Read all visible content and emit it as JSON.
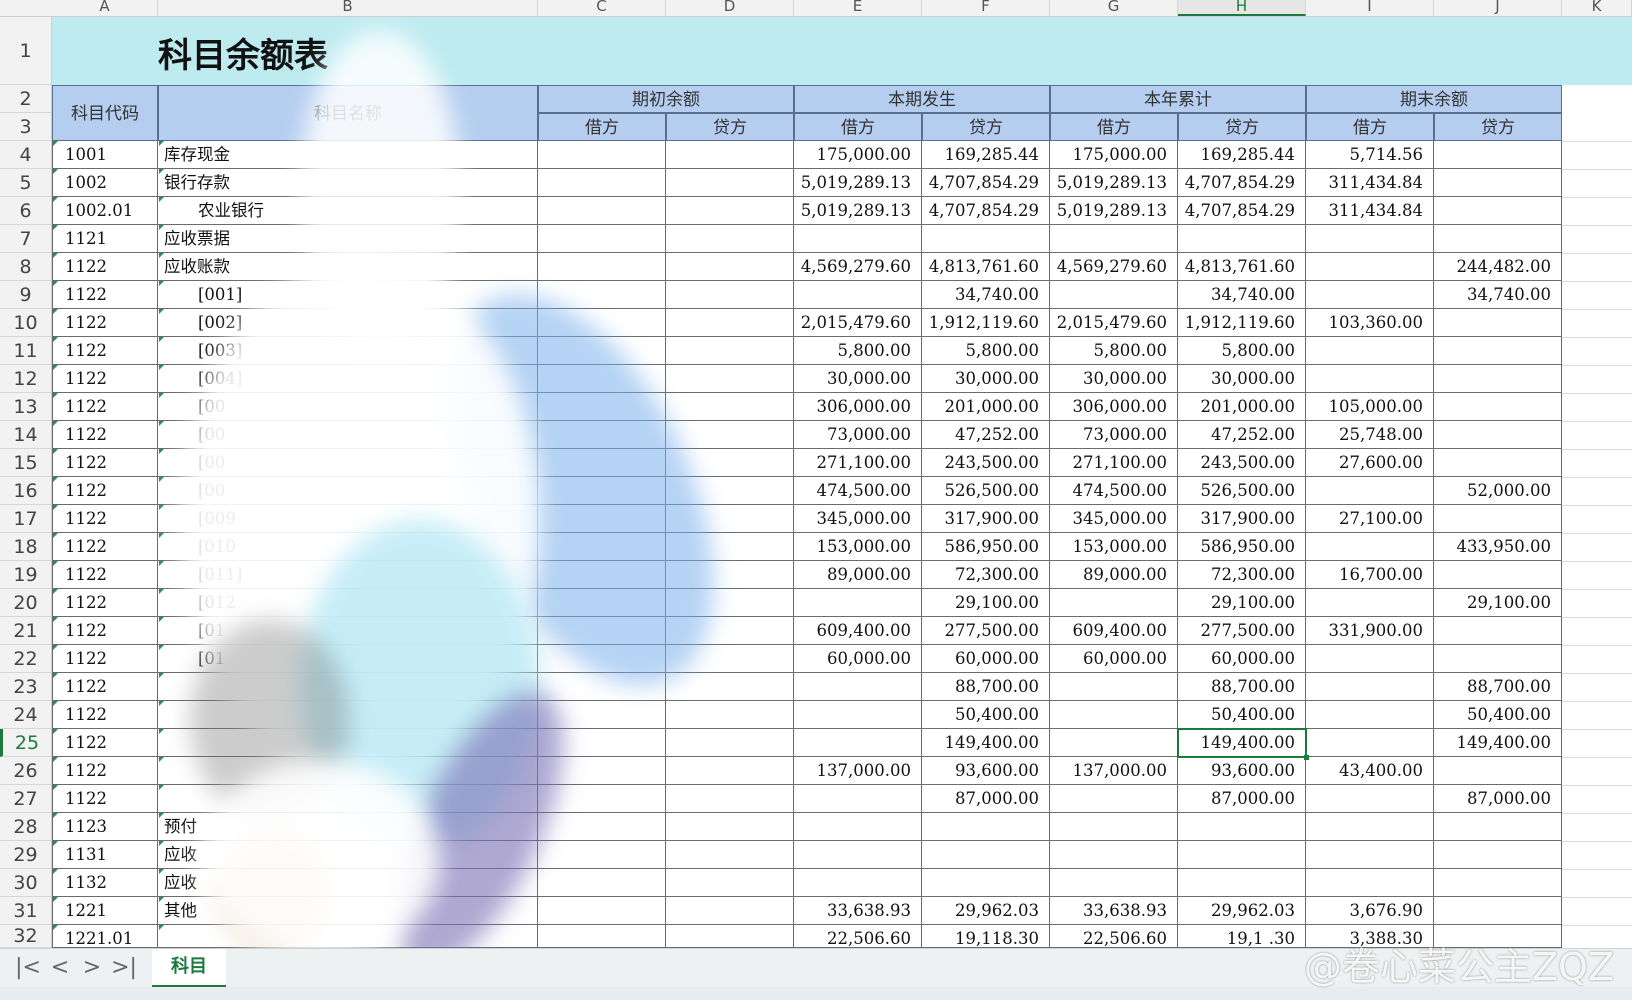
{
  "columns": [
    "A",
    "B",
    "C",
    "D",
    "E",
    "F",
    "G",
    "H",
    "I",
    "J",
    "K"
  ],
  "selected_column": "H",
  "selected_row": "25",
  "title": "科目余额表",
  "headers": {
    "code": "科目代码",
    "name": "科目名称",
    "groups": [
      "期初余额",
      "本期发生",
      "本年累计",
      "期末余额"
    ],
    "debit": "借方",
    "credit": "贷方"
  },
  "rows": [
    {
      "n": "4",
      "code": "1001",
      "name": "库存现金",
      "indent": false,
      "c": "",
      "d": "",
      "e": "175,000.00",
      "f": "169,285.44",
      "g": "175,000.00",
      "h": "169,285.44",
      "i": "5,714.56",
      "j": ""
    },
    {
      "n": "5",
      "code": "1002",
      "name": "银行存款",
      "indent": false,
      "c": "",
      "d": "",
      "e": "5,019,289.13",
      "f": "4,707,854.29",
      "g": "5,019,289.13",
      "h": "4,707,854.29",
      "i": "311,434.84",
      "j": ""
    },
    {
      "n": "6",
      "code": "1002.01",
      "name": "农业银行",
      "indent": true,
      "c": "",
      "d": "",
      "e": "5,019,289.13",
      "f": "4,707,854.29",
      "g": "5,019,289.13",
      "h": "4,707,854.29",
      "i": "311,434.84",
      "j": ""
    },
    {
      "n": "7",
      "code": "1121",
      "name": "应收票据",
      "indent": false,
      "c": "",
      "d": "",
      "e": "",
      "f": "",
      "g": "",
      "h": "",
      "i": "",
      "j": ""
    },
    {
      "n": "8",
      "code": "1122",
      "name": "应收账款",
      "indent": false,
      "c": "",
      "d": "",
      "e": "4,569,279.60",
      "f": "4,813,761.60",
      "g": "4,569,279.60",
      "h": "4,813,761.60",
      "i": "",
      "j": "244,482.00"
    },
    {
      "n": "9",
      "code": "1122",
      "name": "[001]",
      "indent": true,
      "c": "",
      "d": "",
      "e": "",
      "f": "34,740.00",
      "g": "",
      "h": "34,740.00",
      "i": "",
      "j": "34,740.00"
    },
    {
      "n": "10",
      "code": "1122",
      "name": "[002]",
      "indent": true,
      "c": "",
      "d": "",
      "e": "2,015,479.60",
      "f": "1,912,119.60",
      "g": "2,015,479.60",
      "h": "1,912,119.60",
      "i": "103,360.00",
      "j": ""
    },
    {
      "n": "11",
      "code": "1122",
      "name": "[003]",
      "indent": true,
      "c": "",
      "d": "",
      "e": "5,800.00",
      "f": "5,800.00",
      "g": "5,800.00",
      "h": "5,800.00",
      "i": "",
      "j": ""
    },
    {
      "n": "12",
      "code": "1122",
      "name": "[004]",
      "indent": true,
      "c": "",
      "d": "",
      "e": "30,000.00",
      "f": "30,000.00",
      "g": "30,000.00",
      "h": "30,000.00",
      "i": "",
      "j": ""
    },
    {
      "n": "13",
      "code": "1122",
      "name": "[00",
      "indent": true,
      "c": "",
      "d": "",
      "e": "306,000.00",
      "f": "201,000.00",
      "g": "306,000.00",
      "h": "201,000.00",
      "i": "105,000.00",
      "j": ""
    },
    {
      "n": "14",
      "code": "1122",
      "name": "[00",
      "indent": true,
      "c": "",
      "d": "",
      "e": "73,000.00",
      "f": "47,252.00",
      "g": "73,000.00",
      "h": "47,252.00",
      "i": "25,748.00",
      "j": ""
    },
    {
      "n": "15",
      "code": "1122",
      "name": "[00",
      "indent": true,
      "c": "",
      "d": "",
      "e": "271,100.00",
      "f": "243,500.00",
      "g": "271,100.00",
      "h": "243,500.00",
      "i": "27,600.00",
      "j": ""
    },
    {
      "n": "16",
      "code": "1122",
      "name": "[00",
      "indent": true,
      "c": "",
      "d": "",
      "e": "474,500.00",
      "f": "526,500.00",
      "g": "474,500.00",
      "h": "526,500.00",
      "i": "",
      "j": "52,000.00"
    },
    {
      "n": "17",
      "code": "1122",
      "name": "[009",
      "indent": true,
      "c": "",
      "d": "",
      "e": "345,000.00",
      "f": "317,900.00",
      "g": "345,000.00",
      "h": "317,900.00",
      "i": "27,100.00",
      "j": ""
    },
    {
      "n": "18",
      "code": "1122",
      "name": "[010",
      "indent": true,
      "c": "",
      "d": "",
      "e": "153,000.00",
      "f": "586,950.00",
      "g": "153,000.00",
      "h": "586,950.00",
      "i": "",
      "j": "433,950.00"
    },
    {
      "n": "19",
      "code": "1122",
      "name": "[011]",
      "indent": true,
      "c": "",
      "d": "",
      "e": "89,000.00",
      "f": "72,300.00",
      "g": "89,000.00",
      "h": "72,300.00",
      "i": "16,700.00",
      "j": ""
    },
    {
      "n": "20",
      "code": "1122",
      "name": "[012",
      "indent": true,
      "c": "",
      "d": "",
      "e": "",
      "f": "29,100.00",
      "g": "",
      "h": "29,100.00",
      "i": "",
      "j": "29,100.00"
    },
    {
      "n": "21",
      "code": "1122",
      "name": "[01",
      "indent": true,
      "c": "",
      "d": "",
      "e": "609,400.00",
      "f": "277,500.00",
      "g": "609,400.00",
      "h": "277,500.00",
      "i": "331,900.00",
      "j": ""
    },
    {
      "n": "22",
      "code": "1122",
      "name": "[01",
      "indent": true,
      "c": "",
      "d": "",
      "e": "60,000.00",
      "f": "60,000.00",
      "g": "60,000.00",
      "h": "60,000.00",
      "i": "",
      "j": ""
    },
    {
      "n": "23",
      "code": "1122",
      "name": "",
      "indent": true,
      "c": "",
      "d": "",
      "e": "",
      "f": "88,700.00",
      "g": "",
      "h": "88,700.00",
      "i": "",
      "j": "88,700.00"
    },
    {
      "n": "24",
      "code": "1122",
      "name": "",
      "indent": true,
      "c": "",
      "d": "",
      "e": "",
      "f": "50,400.00",
      "g": "",
      "h": "50,400.00",
      "i": "",
      "j": "50,400.00"
    },
    {
      "n": "25",
      "code": "1122",
      "name": "",
      "indent": true,
      "c": "",
      "d": "",
      "e": "",
      "f": "149,400.00",
      "g": "",
      "h": "149,400.00",
      "i": "",
      "j": "149,400.00"
    },
    {
      "n": "26",
      "code": "1122",
      "name": "",
      "indent": true,
      "c": "",
      "d": "",
      "e": "137,000.00",
      "f": "93,600.00",
      "g": "137,000.00",
      "h": "93,600.00",
      "i": "43,400.00",
      "j": ""
    },
    {
      "n": "27",
      "code": "1122",
      "name": "",
      "indent": true,
      "c": "",
      "d": "",
      "e": "",
      "f": "87,000.00",
      "g": "",
      "h": "87,000.00",
      "i": "",
      "j": "87,000.00"
    },
    {
      "n": "28",
      "code": "1123",
      "name": "预付",
      "indent": false,
      "c": "",
      "d": "",
      "e": "",
      "f": "",
      "g": "",
      "h": "",
      "i": "",
      "j": ""
    },
    {
      "n": "29",
      "code": "1131",
      "name": "应收",
      "indent": false,
      "c": "",
      "d": "",
      "e": "",
      "f": "",
      "g": "",
      "h": "",
      "i": "",
      "j": ""
    },
    {
      "n": "30",
      "code": "1132",
      "name": "应收",
      "indent": false,
      "c": "",
      "d": "",
      "e": "",
      "f": "",
      "g": "",
      "h": "",
      "i": "",
      "j": ""
    },
    {
      "n": "31",
      "code": "1221",
      "name": "其他",
      "indent": false,
      "c": "",
      "d": "",
      "e": "33,638.93",
      "f": "29,962.03",
      "g": "33,638.93",
      "h": "29,962.03",
      "i": "3,676.90",
      "j": ""
    },
    {
      "n": "32",
      "code": "1221.01",
      "name": "",
      "indent": true,
      "c": "",
      "d": "",
      "e": "22,506.60",
      "f": "19,118.30",
      "g": "22,506.60",
      "h": "19,1 .30",
      "i": "3,388.30",
      "j": ""
    }
  ],
  "sheet_tab": "科目",
  "watermark": "@卷心菜公主ZQZ",
  "nav": {
    "first": "|<",
    "prev": "<",
    "next": ">",
    "last": ">|"
  },
  "colors": {
    "title_band": "#bdebf0",
    "header_fill": "#b5cef0",
    "selection": "#1e7a3c"
  }
}
